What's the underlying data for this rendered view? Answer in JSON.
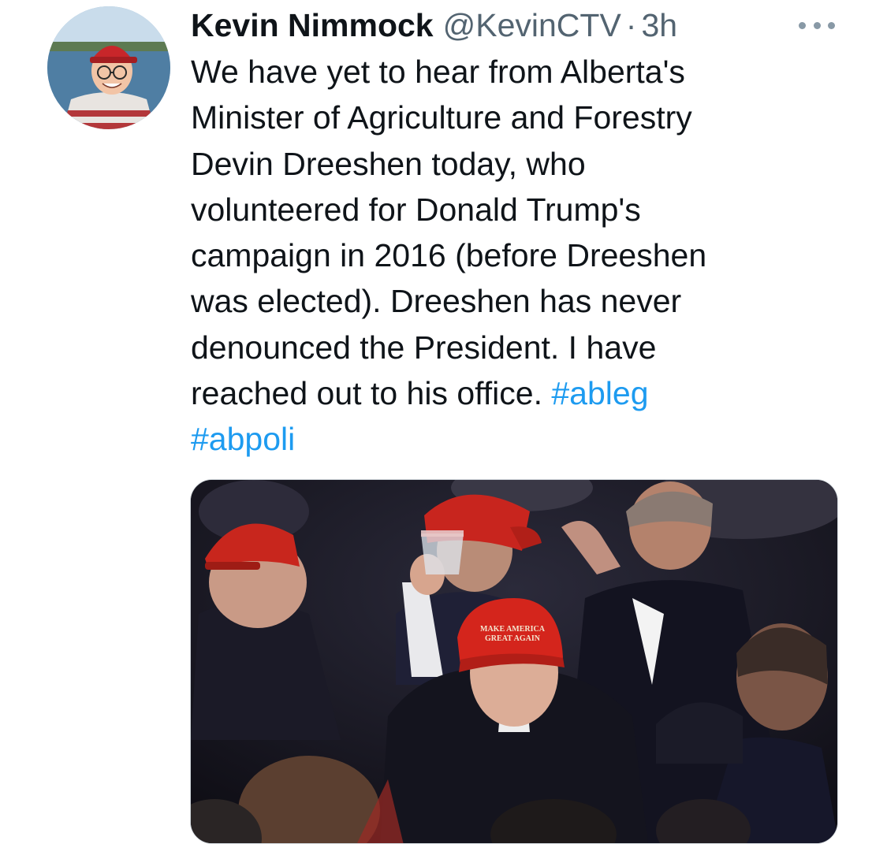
{
  "tweet": {
    "author": {
      "display_name": "Kevin Nimmock",
      "handle": "@KevinCTV",
      "separator": "·",
      "time": "3h",
      "avatar_icon": "profile-photo"
    },
    "more_icon": "more-horizontal-icon",
    "text_lines": [
      "We have yet to hear from Alberta's",
      "Minister of Agriculture and Forestry",
      "Devin Dreeshen today, who",
      "volunteered for Donald Trump's",
      "campaign in 2016 (before Dreeshen",
      "was elected). Dreeshen has never",
      "denounced the President. I have"
    ],
    "last_line_text": "reached out to his office. ",
    "hashtags": [
      "#ableg",
      "#abpoli"
    ],
    "media": {
      "type": "photo",
      "hat_text_line1": "MAKE AMERICA",
      "hat_text_line2": "GREAT AGAIN"
    }
  },
  "colors": {
    "text": "#0f1419",
    "secondary": "#536471",
    "link": "#1d9bf0",
    "hat_red": "#d4251c"
  }
}
